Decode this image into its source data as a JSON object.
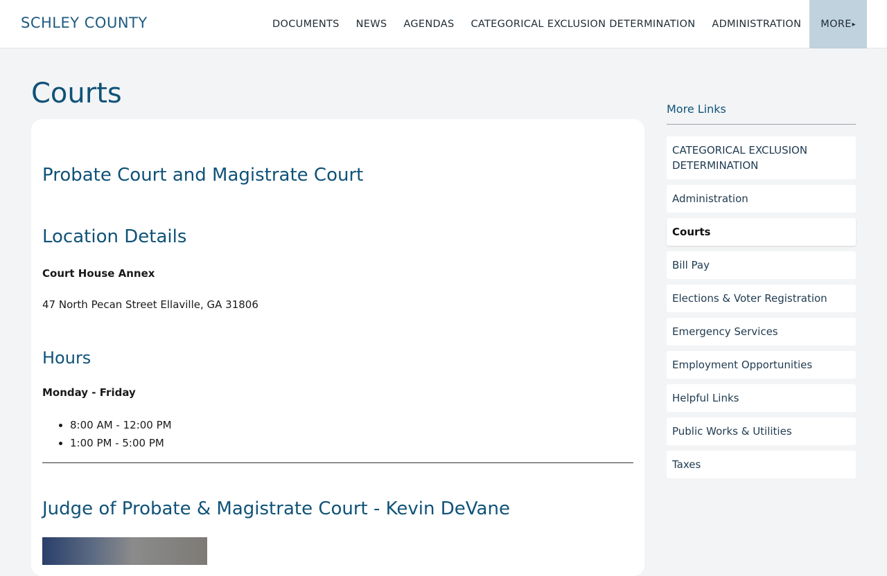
{
  "header": {
    "brand": "SCHLEY COUNTY",
    "nav": [
      {
        "label": "DOCUMENTS"
      },
      {
        "label": "NEWS"
      },
      {
        "label": "AGENDAS"
      },
      {
        "label": "CATEGORICAL EXCLUSION DETERMINATION"
      },
      {
        "label": "ADMINISTRATION"
      },
      {
        "label": "MORE"
      }
    ],
    "more_caret": "▸"
  },
  "page": {
    "title": "Courts"
  },
  "main": {
    "court_heading": "Probate Court and Magistrate Court",
    "location_heading": "Location Details",
    "location_name": "Court House Annex",
    "address": "47 North Pecan Street Ellaville, GA 31806",
    "hours_heading": "Hours",
    "hours_days": "Monday - Friday",
    "hours": [
      "8:00 AM - 12:00 PM",
      "1:00 PM - 5:00 PM"
    ],
    "judge_heading": "Judge of Probate & Magistrate Court - Kevin DeVane"
  },
  "sidebar": {
    "title": "More Links",
    "items": [
      {
        "label": "CATEGORICAL EXCLUSION DETERMINATION"
      },
      {
        "label": "Administration"
      },
      {
        "label": "Courts"
      },
      {
        "label": "Bill Pay"
      },
      {
        "label": "Elections & Voter Registration"
      },
      {
        "label": "Emergency Services"
      },
      {
        "label": "Employment Opportunities"
      },
      {
        "label": "Helpful Links"
      },
      {
        "label": "Public Works & Utilities"
      },
      {
        "label": "Taxes"
      }
    ]
  }
}
